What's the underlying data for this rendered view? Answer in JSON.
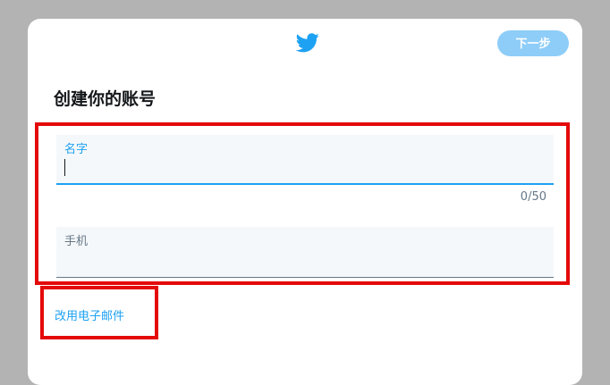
{
  "header": {
    "logo_icon": "bird-icon",
    "next_label": "下一步"
  },
  "form": {
    "title": "创建你的账号",
    "name_label": "名字",
    "name_value": "",
    "name_counter": "0/50",
    "phone_label": "手机",
    "phone_value": "",
    "use_email_label": "改用电子邮件"
  },
  "colors": {
    "brand": "#1da1f2",
    "next_button_disabled": "#8ecdf8",
    "field_background": "#f5f8fa",
    "highlight_box": "#e40a0a"
  }
}
